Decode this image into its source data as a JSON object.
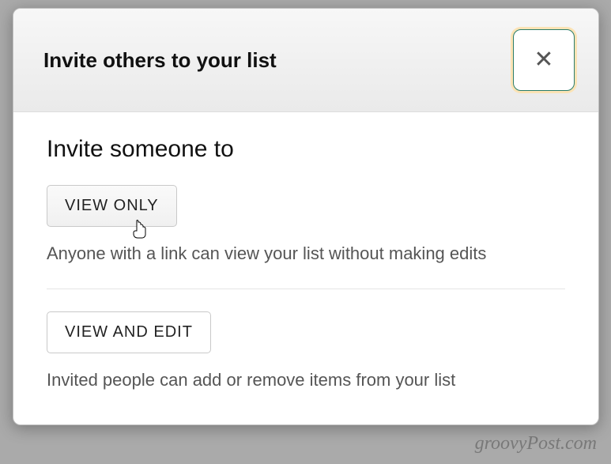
{
  "dialog": {
    "title": "Invite others to your list",
    "close_label": "✕"
  },
  "content": {
    "heading": "Invite someone to",
    "options": [
      {
        "label": "VIEW ONLY",
        "description": "Anyone with a link can view your list without making edits"
      },
      {
        "label": "VIEW AND EDIT",
        "description": "Invited people can add or remove items from your list"
      }
    ]
  },
  "watermark": "groovyPost.com"
}
